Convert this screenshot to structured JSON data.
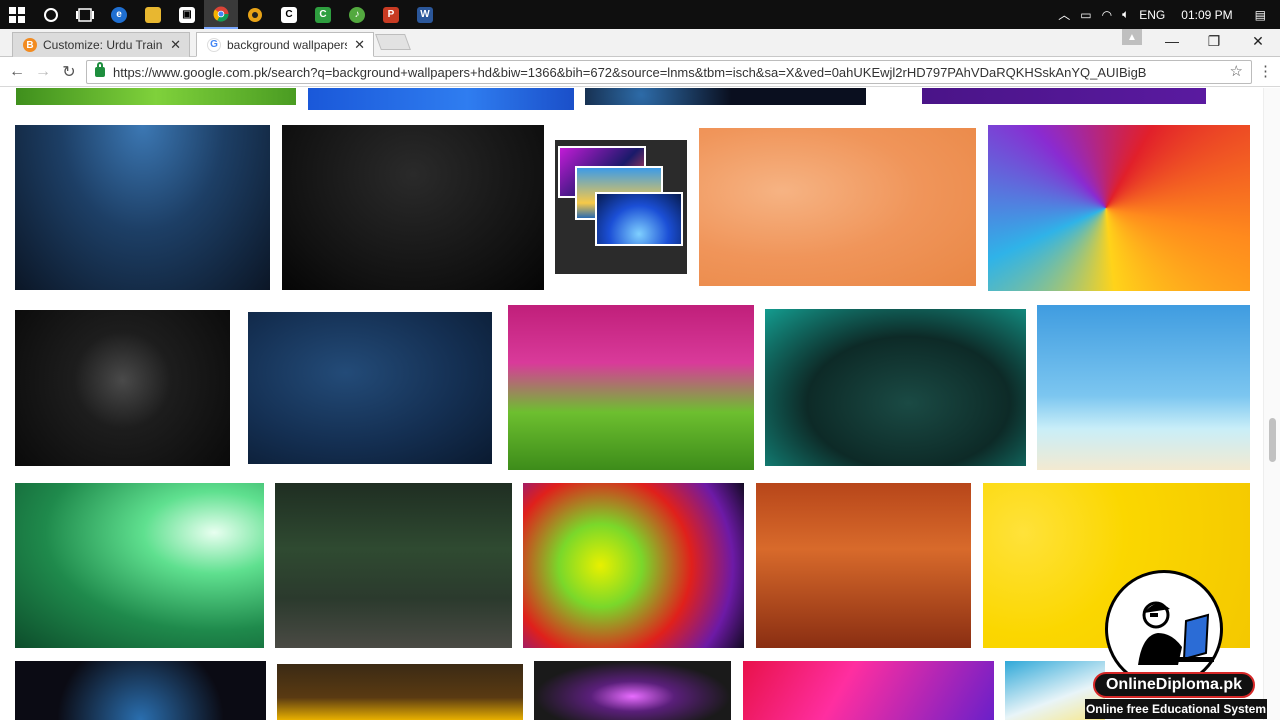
{
  "taskbar": {
    "language": "ENG",
    "time": "01:09 PM",
    "apps": [
      "start-icon",
      "cortana-icon",
      "task-view-icon",
      "edge-icon",
      "file-explorer-icon",
      "store-icon",
      "chrome-icon",
      "app-icon",
      "camtasia-icon",
      "excel-icon",
      "app-green-icon",
      "powerpoint-icon",
      "word-icon"
    ]
  },
  "browser": {
    "tabs": [
      {
        "label": "Customize: Urdu Training"
      },
      {
        "label": "background wallpapers"
      }
    ],
    "url": "https://www.google.com.pk/search?q=background+wallpapers+hd&biw=1366&bih=672&source=lnms&tbm=isch&sa=X&ved=0ahUKEwjl2rHD797PAhVDaRQKHSskAnYQ_AUIBigB"
  },
  "images": [
    {
      "name": "green-grass"
    },
    {
      "name": "blue-abstract"
    },
    {
      "name": "dark-bokeh"
    },
    {
      "name": "purple-gradient"
    },
    {
      "name": "blue-damask"
    },
    {
      "name": "black-swirl"
    },
    {
      "name": "wallpaper-stack"
    },
    {
      "name": "orange-floral"
    },
    {
      "name": "colorful-smoke"
    },
    {
      "name": "dark-diamond"
    },
    {
      "name": "blue-grunge"
    },
    {
      "name": "pink-flowers"
    },
    {
      "name": "zen-stones"
    },
    {
      "name": "beach-hammock"
    },
    {
      "name": "green-bokeh"
    },
    {
      "name": "tiger-forest"
    },
    {
      "name": "rainbow-blur"
    },
    {
      "name": "autumn-railway"
    },
    {
      "name": "yellow-sunflower"
    },
    {
      "name": "stage-lights"
    },
    {
      "name": "brown-gold"
    },
    {
      "name": "neon-glow"
    },
    {
      "name": "pink-abstract"
    },
    {
      "name": "daisy"
    }
  ],
  "watermark": {
    "title": "OnlineDiploma.pk",
    "subtitle": "Online free Educational System"
  }
}
